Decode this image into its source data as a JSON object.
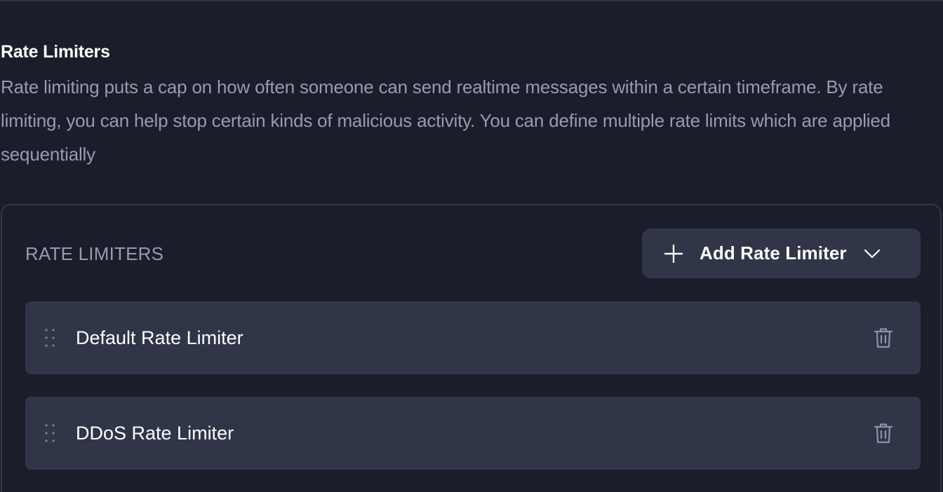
{
  "section": {
    "title": "Rate Limiters",
    "description": "Rate limiting puts a cap on how often someone can send realtime messages within a certain timeframe. By rate limiting, you can help stop certain kinds of malicious activity. You can define multiple rate limits which are applied sequentially"
  },
  "card": {
    "header": "RATE LIMITERS",
    "add_button": {
      "label": "Add Rate Limiter",
      "icon": "plus-icon",
      "dropdown_icon": "chevron-down-icon"
    },
    "items": [
      {
        "name": "Default Rate Limiter",
        "drag_icon": "drag-handle-icon",
        "delete_icon": "trash-icon"
      },
      {
        "name": "DDoS Rate Limiter",
        "drag_icon": "drag-handle-icon",
        "delete_icon": "trash-icon"
      }
    ]
  },
  "colors": {
    "background": "#1b1d2a",
    "surface": "#313548",
    "border": "#33374a",
    "text_primary": "#ffffff",
    "text_secondary": "#979bb3"
  }
}
